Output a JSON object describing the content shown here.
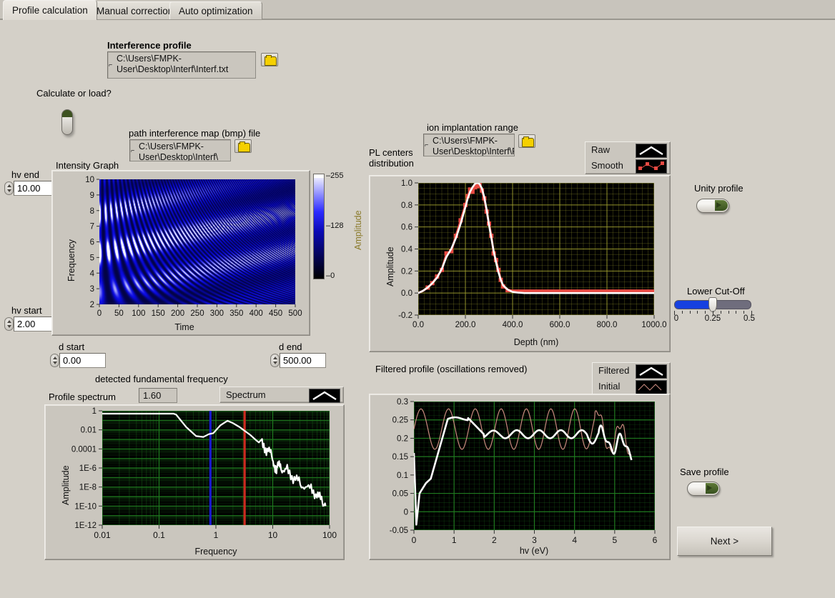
{
  "window": {
    "background": "#d4d0c8"
  },
  "tabs": [
    {
      "label": "Profile calculation",
      "active": true
    },
    {
      "label": "Manual correction",
      "active": false
    },
    {
      "label": "Auto optimization",
      "active": false
    }
  ],
  "interference_profile": {
    "label": "Interference profile",
    "path": "C:\\Users\\FMPK-User\\Desktop\\Interf\\Interf.txt",
    "browse_icon": "folder-icon"
  },
  "calculate_or_load": {
    "label": "Calculate or load?",
    "state": "off"
  },
  "interference_map": {
    "label": "path interference map (bmp) file",
    "path": "C:\\Users\\FMPK-User\\Desktop\\Interf\\",
    "browse_icon": "folder-icon"
  },
  "ion_implantation": {
    "label": "ion implantation range",
    "path": "C:\\Users\\FMPK-User\\Desktop\\Interf\\RANGE.txt",
    "browse_icon": "folder-icon"
  },
  "hv_end": {
    "label": "hv end",
    "value": "10.00"
  },
  "hv_start": {
    "label": "hv start",
    "value": "2.00"
  },
  "d_start": {
    "label": "d start",
    "value": "0.00"
  },
  "d_end": {
    "label": "d end",
    "value": "500.00"
  },
  "fundamental_frequency": {
    "label": "detected fundamental frequency",
    "value": "1.60"
  },
  "unity_profile": {
    "label": "Unity profile",
    "state": "off"
  },
  "save_profile": {
    "label": "Save profile",
    "state": "off"
  },
  "lower_cutoff": {
    "label": "Lower Cut-Off",
    "value": 0.25,
    "min": 0,
    "max": 0.5,
    "tick_labels": [
      "0",
      "0.25",
      "0.5"
    ]
  },
  "next_button": {
    "label": "Next >"
  },
  "legends": {
    "pl": {
      "items": [
        {
          "label": "Raw",
          "style": "line-white"
        },
        {
          "label": "Smooth",
          "style": "markers-red"
        }
      ]
    },
    "spectrum": {
      "items": [
        {
          "label": "Spectrum",
          "style": "line-white"
        }
      ]
    },
    "filtered": {
      "items": [
        {
          "label": "Filtered",
          "style": "line-white"
        },
        {
          "label": "Initial",
          "style": "line-salmon"
        }
      ]
    }
  },
  "chart_data": [
    {
      "id": "intensity-graph",
      "type": "heatmap",
      "title": "Intensity Graph",
      "xlabel": "Time",
      "ylabel": "Frequency",
      "xlim": [
        0,
        500
      ],
      "ylim": [
        2,
        10
      ],
      "xticks": [
        0,
        50,
        100,
        150,
        200,
        250,
        300,
        350,
        400,
        450,
        500
      ],
      "yticks": [
        2,
        3,
        4,
        5,
        6,
        7,
        8,
        9,
        10
      ],
      "colorbar": {
        "label": "Amplitude",
        "min": 0,
        "max": 255,
        "ticks": [
          0,
          128,
          255
        ],
        "colors": [
          "#000000",
          "#1414d2",
          "#ffffff"
        ]
      },
      "description": "Chirped interference fringe map: diagonal bright fringe blobs whose spacing widens with time, fading to dark blue near top (high frequency) and bottom-right."
    },
    {
      "id": "pl-centers-distribution",
      "type": "line",
      "title": "PL centers distribution",
      "xlabel": "Depth (nm)",
      "ylabel": "Amplitude",
      "xlim": [
        0,
        1000
      ],
      "ylim": [
        -0.2,
        1.0
      ],
      "xticks": [
        0.0,
        200.0,
        400.0,
        600.0,
        800.0,
        1000.0
      ],
      "yticks": [
        -0.2,
        0.0,
        0.2,
        0.4,
        0.6,
        0.8,
        1.0
      ],
      "grid": true,
      "grid_color": "#b3b33a",
      "x": [
        0,
        20,
        40,
        60,
        80,
        100,
        120,
        140,
        160,
        180,
        200,
        210,
        220,
        230,
        240,
        250,
        260,
        270,
        280,
        290,
        300,
        310,
        320,
        330,
        340,
        350,
        360,
        380,
        400,
        420,
        450,
        500,
        600,
        700,
        800,
        900,
        1000
      ],
      "series": [
        {
          "name": "Raw",
          "color": "#ffffff",
          "values": [
            0.0,
            0.02,
            0.05,
            0.09,
            0.14,
            0.22,
            0.33,
            0.4,
            0.5,
            0.63,
            0.78,
            0.86,
            0.92,
            0.96,
            0.99,
            1.0,
            0.99,
            0.95,
            0.87,
            0.76,
            0.62,
            0.5,
            0.38,
            0.28,
            0.19,
            0.12,
            0.07,
            0.03,
            0.01,
            0.005,
            0.0,
            0.0,
            0.0,
            0.0,
            0.0,
            0.0,
            0.0
          ]
        },
        {
          "name": "Smooth",
          "color": "#e84a43",
          "values": [
            0.0,
            0.02,
            0.05,
            0.09,
            0.15,
            0.21,
            0.36,
            0.38,
            0.52,
            0.66,
            0.8,
            0.88,
            0.94,
            0.92,
            0.96,
            0.97,
            0.98,
            0.93,
            0.86,
            0.74,
            0.63,
            0.52,
            0.36,
            0.3,
            0.21,
            0.12,
            0.06,
            0.03,
            0.02,
            0.02,
            0.02,
            0.02,
            0.02,
            0.02,
            0.02,
            0.02,
            0.02
          ]
        }
      ]
    },
    {
      "id": "profile-spectrum",
      "type": "line",
      "title": "Profile spectrum",
      "xlabel": "Frequency",
      "ylabel": "Amplitude",
      "xscale": "log",
      "yscale": "log",
      "xlim": [
        0.01,
        100
      ],
      "ylim": [
        1e-12,
        1
      ],
      "xticks": [
        0.01,
        0.1,
        1,
        10,
        100
      ],
      "ytick_labels": [
        "1E-12",
        "1E-10",
        "1E-8",
        "1E-6",
        "0.0001",
        "0.01",
        "1"
      ],
      "grid": true,
      "grid_color": "#1f7a1f",
      "cursors": [
        {
          "name": "blue-cursor",
          "x": 0.8,
          "color": "#1a1ad0"
        },
        {
          "name": "red-cursor",
          "x": 3.2,
          "color": "#cc2a20"
        }
      ],
      "series": [
        {
          "name": "Spectrum",
          "color": "#ffffff",
          "x": [
            0.01,
            0.05,
            0.1,
            0.18,
            0.2,
            0.3,
            0.45,
            0.6,
            0.75,
            0.9,
            1.2,
            1.6,
            2.0,
            2.6,
            3.2,
            4.0,
            5.0,
            6.5,
            8.0,
            10.0,
            11.0,
            12.0,
            14.0,
            18.0,
            24.0,
            32.0,
            45.0,
            60.0,
            75.0,
            85.0
          ],
          "y": [
            0.5,
            0.5,
            0.5,
            0.5,
            0.4,
            0.02,
            0.0022,
            0.0018,
            0.0035,
            0.0045,
            0.03,
            0.09,
            0.05,
            0.02,
            0.008,
            0.003,
            0.0009,
            0.00025,
            8e-05,
            1.5e-05,
            4e-07,
            2e-06,
            1e-06,
            5e-07,
            8e-08,
            2e-08,
            8e-09,
            1.5e-09,
            3e-10,
            1e-10
          ]
        }
      ]
    },
    {
      "id": "filtered-profile",
      "type": "line",
      "title": "Filtered profile (oscillations removed)",
      "xlabel": "hv (eV)",
      "ylabel": "",
      "xlim": [
        0,
        6
      ],
      "ylim": [
        -0.05,
        0.3
      ],
      "xticks": [
        0,
        1,
        2,
        3,
        4,
        5,
        6
      ],
      "yticks": [
        -0.05,
        0,
        0.05,
        0.1,
        0.15,
        0.2,
        0.25,
        0.3
      ],
      "grid": true,
      "grid_color": "#1f7a1f",
      "series": [
        {
          "name": "Initial",
          "color": "#c98a7e",
          "description": "Sinusoidal oscillation about ~0.22 with amplitude ~0.05, period ~0.7 eV, damping after 4.5 eV, ends near 0.12 at 5.4 eV"
        },
        {
          "name": "Filtered",
          "color": "#ffffff",
          "description": "Starts 0.16 at 0, dips to -0.035 near 0.12, rises through 0.08 plateau at 0.35, climbs to 0.255 plateau from 0.85-1.35, settles to ~0.21 with small ripples, decays toward 0.17 after 5 eV"
        }
      ]
    }
  ]
}
